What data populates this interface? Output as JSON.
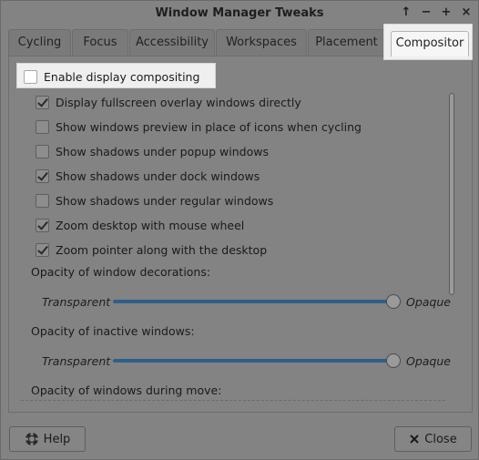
{
  "window": {
    "title": "Window Manager Tweaks",
    "controls": [
      "↑",
      "−",
      "+",
      "×"
    ]
  },
  "tabs": [
    {
      "label": "Cycling"
    },
    {
      "label": "Focus"
    },
    {
      "label": "Accessibility"
    },
    {
      "label": "Workspaces"
    },
    {
      "label": "Placement"
    },
    {
      "label": "Compositor",
      "active": true
    }
  ],
  "compositor": {
    "enable_label": "Enable display compositing",
    "enable_checked": false,
    "options": [
      {
        "label": "Display fullscreen overlay windows directly",
        "checked": true
      },
      {
        "label": "Show windows preview in place of icons when cycling",
        "checked": false
      },
      {
        "label": "Show shadows under popup windows",
        "checked": false
      },
      {
        "label": "Show shadows under dock windows",
        "checked": true
      },
      {
        "label": "Show shadows under regular windows",
        "checked": false
      },
      {
        "label": "Zoom desktop with mouse wheel",
        "checked": true
      },
      {
        "label": "Zoom pointer along with the desktop",
        "checked": true
      }
    ],
    "sliders": [
      {
        "label": "Opacity of window decorations:",
        "min_label": "Transparent",
        "max_label": "Opaque",
        "value": 1.0
      },
      {
        "label": "Opacity of inactive windows:",
        "min_label": "Transparent",
        "max_label": "Opaque",
        "value": 1.0
      }
    ],
    "next_section_label": "Opacity of windows during move:"
  },
  "buttons": {
    "help": "Help",
    "close": "Close"
  },
  "colors": {
    "slider_track": "#2e5f8a",
    "highlight": "#efefef"
  }
}
